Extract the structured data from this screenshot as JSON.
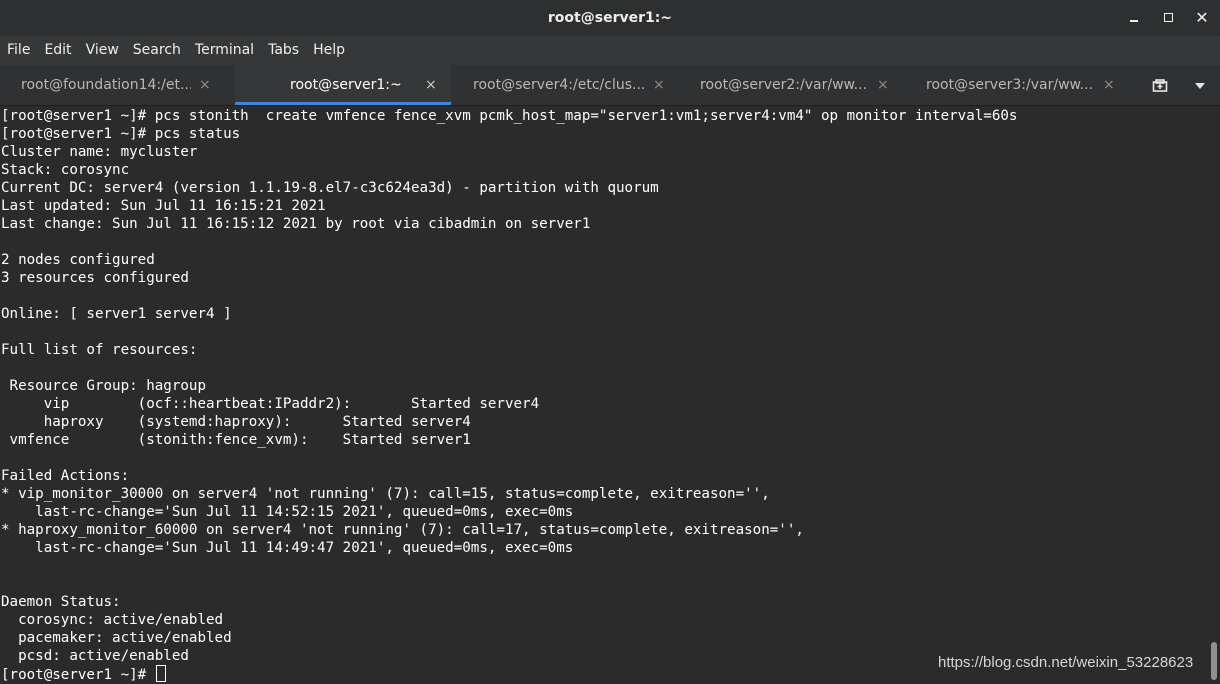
{
  "window": {
    "title": "root@server1:~"
  },
  "menu": [
    "File",
    "Edit",
    "View",
    "Search",
    "Terminal",
    "Tabs",
    "Help"
  ],
  "tabs": [
    {
      "label": "root@foundation14:/et...",
      "active": false
    },
    {
      "label": "root@server1:~",
      "active": true
    },
    {
      "label": "root@server4:/etc/clus...",
      "active": false
    },
    {
      "label": "root@server2:/var/ww...",
      "active": false
    },
    {
      "label": "root@server3:/var/ww...",
      "active": false
    }
  ],
  "tab_close_glyph": "×",
  "terminal": {
    "lines": [
      "[root@server1 ~]# pcs stonith  create vmfence fence_xvm pcmk_host_map=\"server1:vm1;server4:vm4\" op monitor interval=60s",
      "[root@server1 ~]# pcs status",
      "Cluster name: mycluster",
      "Stack: corosync",
      "Current DC: server4 (version 1.1.19-8.el7-c3c624ea3d) - partition with quorum",
      "Last updated: Sun Jul 11 16:15:21 2021",
      "Last change: Sun Jul 11 16:15:12 2021 by root via cibadmin on server1",
      "",
      "2 nodes configured",
      "3 resources configured",
      "",
      "Online: [ server1 server4 ]",
      "",
      "Full list of resources:",
      "",
      " Resource Group: hagroup",
      "     vip        (ocf::heartbeat:IPaddr2):       Started server4",
      "     haproxy    (systemd:haproxy):      Started server4",
      " vmfence        (stonith:fence_xvm):    Started server1",
      "",
      "Failed Actions:",
      "* vip_monitor_30000 on server4 'not running' (7): call=15, status=complete, exitreason='',",
      "    last-rc-change='Sun Jul 11 14:52:15 2021', queued=0ms, exec=0ms",
      "* haproxy_monitor_60000 on server4 'not running' (7): call=17, status=complete, exitreason='',",
      "    last-rc-change='Sun Jul 11 14:49:47 2021', queued=0ms, exec=0ms",
      "",
      "",
      "Daemon Status:",
      "  corosync: active/enabled",
      "  pacemaker: active/enabled",
      "  pcsd: active/enabled"
    ],
    "prompt": "[root@server1 ~]# "
  },
  "watermark": "https://blog.csdn.net/weixin_53228623",
  "colors": {
    "terminal_bg": "#2b2b2b",
    "terminal_fg": "#ffffff",
    "active_tab_underline": "#3d86d8"
  }
}
